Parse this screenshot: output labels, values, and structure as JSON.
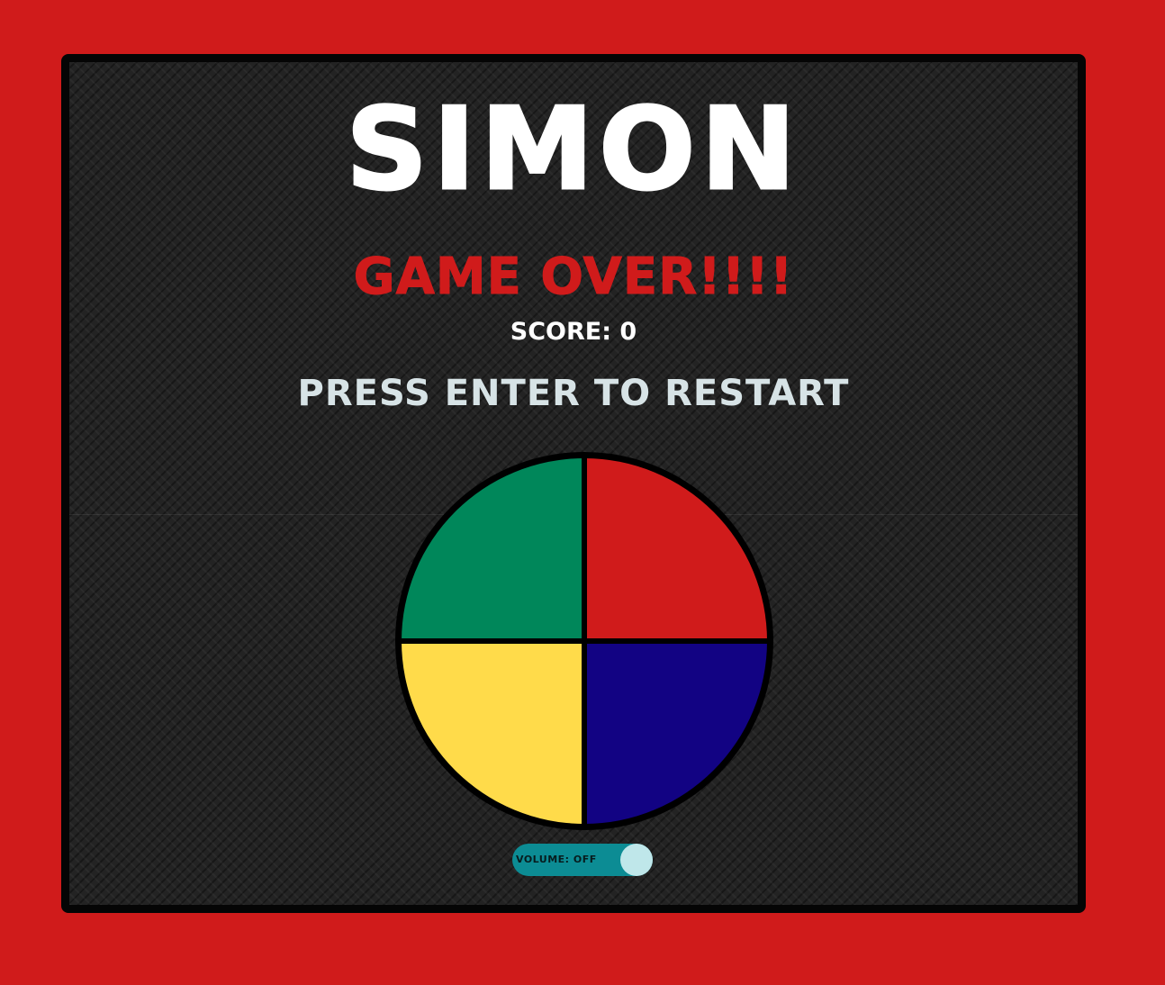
{
  "game": {
    "title": "SIMON",
    "status": "GAME OVER!!!!",
    "score_label": "SCORE: 0",
    "prompt": "PRESS ENTER TO RESTART"
  },
  "pads": [
    {
      "color": "green",
      "hex": "#00875a"
    },
    {
      "color": "red",
      "hex": "#d01b1b"
    },
    {
      "color": "yellow",
      "hex": "#ffdb4a"
    },
    {
      "color": "blue",
      "hex": "#120383"
    }
  ],
  "volume": {
    "label": "VOLUME: OFF",
    "state": "off"
  },
  "colors": {
    "background": "#d01b1b",
    "board": "#232323",
    "title": "#ffffff",
    "status": "#d01b1b",
    "prompt": "#d7e3e6",
    "toggle": "#0c8c94",
    "toggle_knob": "#bfe7ea"
  }
}
